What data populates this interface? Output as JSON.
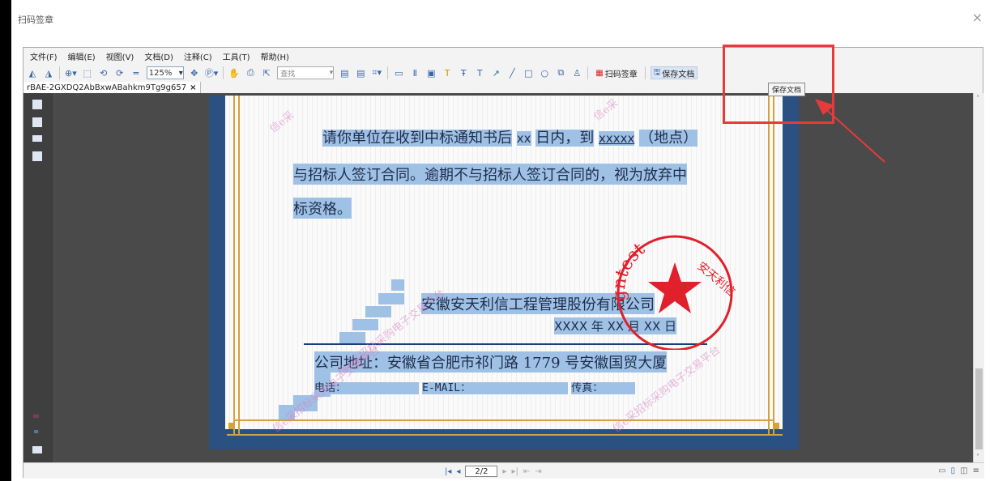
{
  "window": {
    "title": "扫码签章",
    "close": "×"
  },
  "menu": [
    "文件(F)",
    "编辑(E)",
    "视图(V)",
    "文档(D)",
    "注释(C)",
    "工具(T)",
    "帮助(H)"
  ],
  "toolbar": {
    "zoom_value": "125%",
    "find_placeholder": "查找",
    "scan_sign_label": "扫码签章",
    "save_doc_label": "保存文档",
    "tooltip": "保存文档"
  },
  "tab": {
    "label": "rBAE-2GXDQ2AbBxwABahkm9Tg9g657",
    "close": "×"
  },
  "document": {
    "line1_a": "请你单位在收到中标通知书后",
    "line1_b": "xx",
    "line1_c": "日内，到",
    "line1_d": "xxxxx",
    "line1_e": "（地点）",
    "line2": "与招标人签订合同。逾期不与招标人签订合同的，视为放弃中",
    "line3": "标资格。",
    "company": "安徽安天利信工程管理股份有限公司",
    "date": "XXXX 年 XX 月 XX 日",
    "address": "公司地址：安徽省合肥市祁门路 1779 号安徽国贸大厦",
    "phone": "电话：",
    "email": "E-MAIL：",
    "fax": "传真："
  },
  "stamp": {
    "text_en": "gntest",
    "text_cn": "安天利信"
  },
  "watermarks": [
    "信e采",
    "信e采",
    "信e采招标采购电子交易平台",
    "信e采招标采购电子交易平台",
    "信e采招标采购电子交易平台"
  ],
  "pager": {
    "page": "2/2"
  },
  "colors": {
    "highlight": "#9fc1e6",
    "page_border": "#2b5082",
    "gold": "#d4a23f",
    "annotation": "#e83a3a"
  }
}
